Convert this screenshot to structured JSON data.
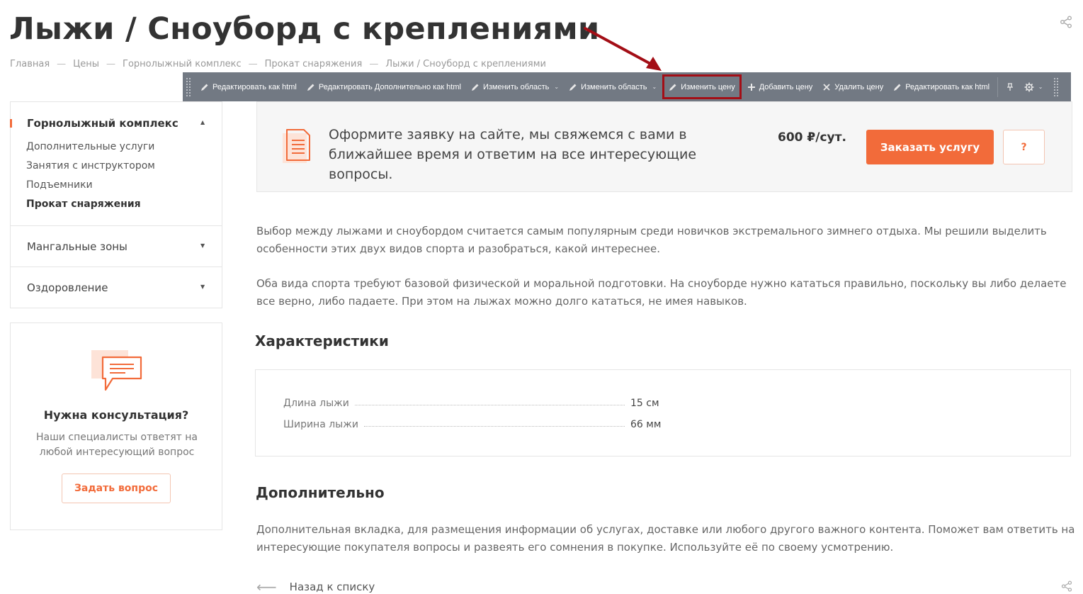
{
  "page": {
    "title": "Лыжи / Сноуборд с креплениями"
  },
  "breadcrumb": {
    "items": [
      "Главная",
      "Цены",
      "Горнолыжный комплекс",
      "Прокат снаряжения",
      "Лыжи / Сноуборд с креплениями"
    ],
    "separator": "—"
  },
  "toolbar": {
    "items": [
      {
        "label": "Редактировать как html",
        "icon": "pencil-icon"
      },
      {
        "label": "Редактировать Дополнительно как html",
        "icon": "pencil-icon"
      },
      {
        "label": "Изменить область",
        "icon": "pencil-icon",
        "dropdown": "⌄"
      },
      {
        "label": "Изменить область",
        "icon": "pencil-icon",
        "dropdown": "⌄"
      },
      {
        "label": "Изменить цену",
        "icon": "pencil-icon",
        "highlighted": true
      },
      {
        "label": "Добавить цену",
        "icon": "plus-icon"
      },
      {
        "label": "Удалить цену",
        "icon": "close-icon"
      },
      {
        "label": "Редактировать как html",
        "icon": "pencil-icon"
      }
    ],
    "pin_icon": "pin-icon",
    "settings_icon": "gear-icon",
    "settings_caret": "⌄"
  },
  "sidebar": {
    "sections": [
      {
        "label": "Горнолыжный комплекс",
        "expanded": true,
        "caret": "▲",
        "children": [
          "Дополнительные услуги",
          "Занятия с инструктором",
          "Подъемники",
          "Прокат снаряжения"
        ],
        "active_child": "Прокат снаряжения"
      },
      {
        "label": "Мангальные зоны",
        "expanded": false,
        "caret": "▼"
      },
      {
        "label": "Оздоровление",
        "expanded": false,
        "caret": "▼"
      }
    ]
  },
  "consult": {
    "title": "Нужна консультация?",
    "text": "Наши специалисты ответят на любой интересующий вопрос",
    "button": "Задать вопрос"
  },
  "order": {
    "text": "Оформите заявку на сайте, мы свяжемся с вами в ближайшее время и ответим на все интересующие вопросы.",
    "price": "600 ₽/сут.",
    "button": "Заказать услугу",
    "question_button": "?"
  },
  "content": {
    "paragraph1": "Выбор между лыжами и сноубордом считается самым популярным среди новичков экстремального зимнего отдыха. Мы решили выделить особенности этих двух видов спорта и разобраться, какой интереснее.",
    "paragraph2": "Оба вида спорта требуют базовой физической и моральной подготовки. На сноуборде нужно кататься правильно, поскольку вы либо делаете все верно, либо падаете. При этом на лыжах можно долго кататься, не имея навыков.",
    "characteristics_title": "Характеристики",
    "characteristics": [
      {
        "name": "Длина лыжи",
        "value": "15 см"
      },
      {
        "name": "Ширина лыжи",
        "value": "66 мм"
      }
    ],
    "additional_title": "Дополнительно",
    "additional_text": "Дополнительная вкладка, для размещения информации об услугах, доставке или любого другого важного контента. Поможет вам ответить на интересующие покупателя вопросы и развеять его сомнения в покупке. Используйте её по своему усмотрению.",
    "back_arrow": "⟵",
    "back_link": "Назад к списку"
  },
  "colors": {
    "accent": "#f26b3a",
    "toolbar_bg": "#727983",
    "highlight_frame": "#a30e16",
    "annotation_arrow": "#a30e16"
  }
}
